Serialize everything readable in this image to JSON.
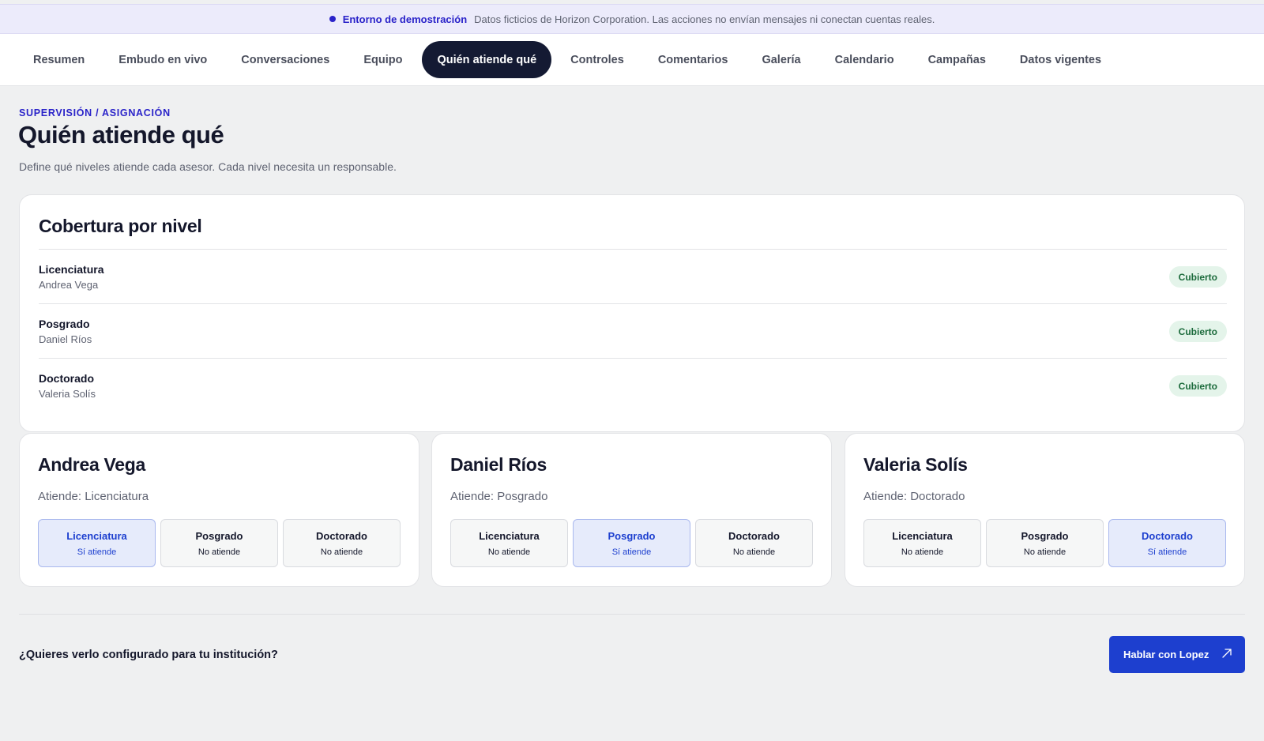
{
  "banner": {
    "label": "Entorno de demostración",
    "text": "Datos ficticios de Horizon Corporation. Las acciones no envían mensajes ni conectan cuentas reales."
  },
  "nav": {
    "tabs": [
      {
        "label": "Resumen"
      },
      {
        "label": "Embudo en vivo"
      },
      {
        "label": "Conversaciones"
      },
      {
        "label": "Equipo"
      },
      {
        "label": "Quién atiende qué",
        "active": true
      },
      {
        "label": "Controles"
      },
      {
        "label": "Comentarios"
      },
      {
        "label": "Galería"
      },
      {
        "label": "Calendario"
      },
      {
        "label": "Campañas"
      },
      {
        "label": "Datos vigentes"
      }
    ]
  },
  "header": {
    "eyebrow": "SUPERVISIÓN / ASIGNACIÓN",
    "title": "Quién atiende qué",
    "description": "Define qué niveles atiende cada asesor. Cada nivel necesita un responsable."
  },
  "coverage": {
    "title": "Cobertura por nivel",
    "rows": [
      {
        "level": "Licenciatura",
        "person": "Andrea Vega",
        "status": "Cubierto"
      },
      {
        "level": "Posgrado",
        "person": "Daniel Ríos",
        "status": "Cubierto"
      },
      {
        "level": "Doctorado",
        "person": "Valeria Solís",
        "status": "Cubierto"
      }
    ]
  },
  "advisors": [
    {
      "name": "Andrea Vega",
      "attends": "Atiende: Licenciatura",
      "options": [
        {
          "level": "Licenciatura",
          "state": "Sí atiende",
          "on": true
        },
        {
          "level": "Posgrado",
          "state": "No atiende",
          "on": false
        },
        {
          "level": "Doctorado",
          "state": "No atiende",
          "on": false
        }
      ]
    },
    {
      "name": "Daniel Ríos",
      "attends": "Atiende: Posgrado",
      "options": [
        {
          "level": "Licenciatura",
          "state": "No atiende",
          "on": false
        },
        {
          "level": "Posgrado",
          "state": "Sí atiende",
          "on": true
        },
        {
          "level": "Doctorado",
          "state": "No atiende",
          "on": false
        }
      ]
    },
    {
      "name": "Valeria Solís",
      "attends": "Atiende: Doctorado",
      "options": [
        {
          "level": "Licenciatura",
          "state": "No atiende",
          "on": false
        },
        {
          "level": "Posgrado",
          "state": "No atiende",
          "on": false
        },
        {
          "level": "Doctorado",
          "state": "Sí atiende",
          "on": true
        }
      ]
    }
  ],
  "cta": {
    "question": "¿Quieres verlo configurado para tu institución?",
    "button_label": "Hablar con Lopez",
    "arrow_icon": "arrow-up-right-icon"
  },
  "colors": {
    "accent": "#1d3fcf",
    "brand_indigo": "#2a23c9",
    "nav_active": "#141a33",
    "covered_badge_bg": "#e4f4ea",
    "covered_badge_text": "#1c6b3c",
    "option_selected_bg": "#e6ebfb"
  }
}
